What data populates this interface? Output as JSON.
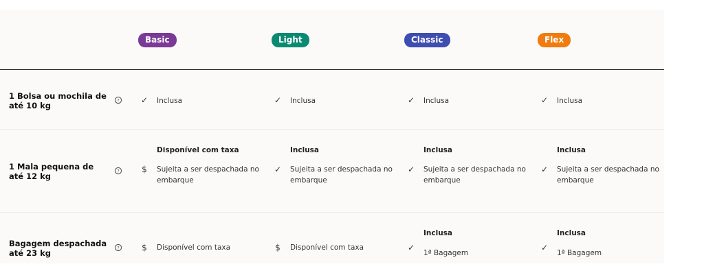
{
  "plans": [
    {
      "name": "Basic",
      "color": "#7b3a96"
    },
    {
      "name": "Light",
      "color": "#0a8a73"
    },
    {
      "name": "Classic",
      "color": "#3d4db0"
    },
    {
      "name": "Flex",
      "color": "#f07c0f"
    }
  ],
  "rows": [
    {
      "label": "1 Bolsa ou mochila de até 10 kg",
      "help_icon": "question-circle-icon",
      "cells": [
        {
          "icon": "check-icon",
          "mark": "✓",
          "text": "Inclusa"
        },
        {
          "icon": "check-icon",
          "mark": "✓",
          "text": "Inclusa"
        },
        {
          "icon": "check-icon",
          "mark": "✓",
          "text": "Inclusa"
        },
        {
          "icon": "check-icon",
          "mark": "✓",
          "text": "Inclusa"
        }
      ]
    },
    {
      "label": "1 Mala pequena de até 12 kg",
      "help_icon": "question-circle-icon",
      "cells": [
        {
          "icon": "dollar-icon",
          "mark": "$",
          "title": "Disponível com taxa",
          "text": "Sujeita a ser despachada no embarque"
        },
        {
          "icon": "check-icon",
          "mark": "✓",
          "title": "Inclusa",
          "text": "Sujeita a ser despachada no embarque"
        },
        {
          "icon": "check-icon",
          "mark": "✓",
          "title": "Inclusa",
          "text": "Sujeita a ser despachada no embarque"
        },
        {
          "icon": "check-icon",
          "mark": "✓",
          "title": "Inclusa",
          "text": "Sujeita a ser despachada no embarque"
        }
      ]
    },
    {
      "label": "Bagagem despachada até 23 kg",
      "help_icon": "question-circle-icon",
      "cells": [
        {
          "icon": "dollar-icon",
          "mark": "$",
          "text": "Disponível com taxa"
        },
        {
          "icon": "dollar-icon",
          "mark": "$",
          "text": "Disponível com taxa"
        },
        {
          "icon": "check-icon",
          "mark": "✓",
          "title": "Inclusa",
          "text": "1ª Bagagem"
        },
        {
          "icon": "check-icon",
          "mark": "✓",
          "title": "Inclusa",
          "text": "1ª Bagagem"
        }
      ]
    }
  ]
}
